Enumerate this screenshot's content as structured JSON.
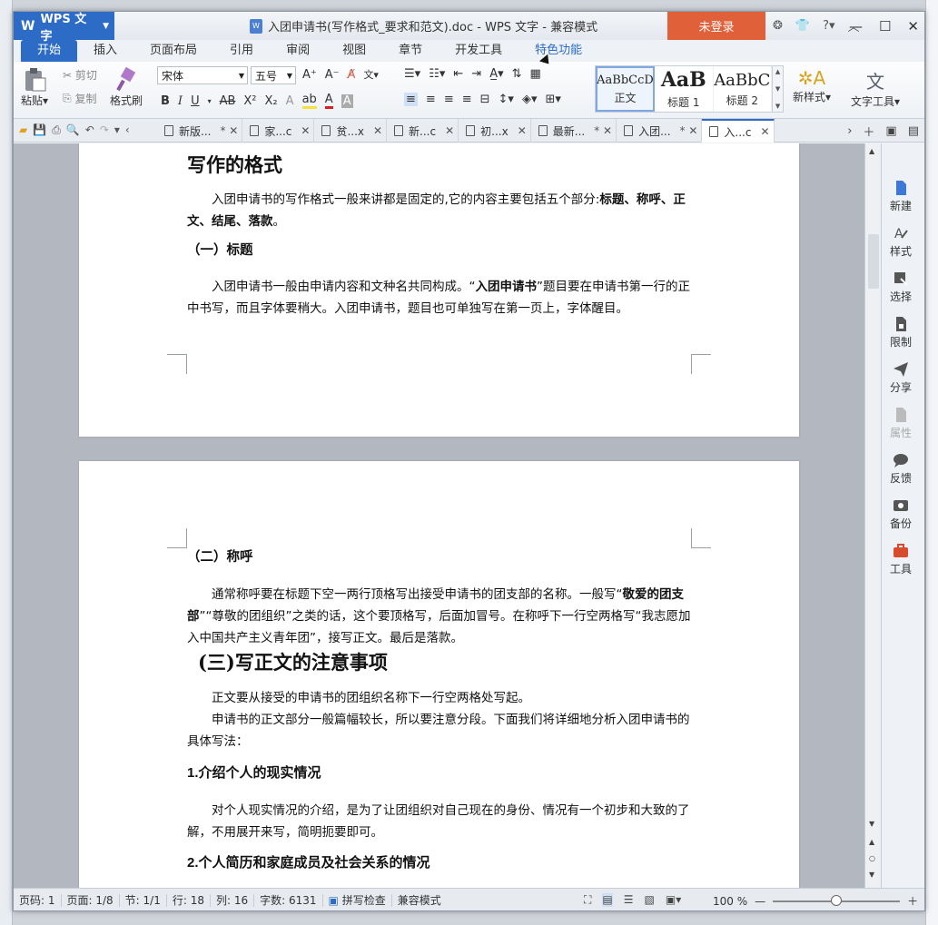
{
  "titlebar": {
    "app_name": "WPS 文字",
    "doc_title": "入团申请书(写作格式_要求和范文).doc - WPS 文字 - 兼容模式",
    "login": "未登录",
    "help": "?"
  },
  "ribbon_tabs": [
    "开始",
    "插入",
    "页面布局",
    "引用",
    "审阅",
    "视图",
    "章节",
    "开发工具",
    "特色功能"
  ],
  "ribbon": {
    "paste": "粘贴",
    "cut": "剪切",
    "copy": "复制",
    "format_painter": "格式刷",
    "font_name": "宋体",
    "font_size": "五号",
    "styles": [
      {
        "sample": "AaBbCcD",
        "label": "正文"
      },
      {
        "sample": "AaB",
        "label": "标题 1"
      },
      {
        "sample": "AaBbC",
        "label": "标题 2"
      }
    ],
    "new_style": "新样式",
    "text_tools": "文字工具"
  },
  "doc_tabs": [
    "新版...",
    "家...c",
    "贫...x",
    "新...c",
    "初...x",
    "最新...",
    "入团...",
    "入...c"
  ],
  "document": {
    "p1_heading": "写作的格式",
    "p1_intro_a": "入团申请书的写作格式一般来讲都是固定的,它的内容主要包括五个部分:",
    "p1_intro_b": "标题、称呼、正文、结尾、落款",
    "p1_intro_c": "。",
    "p1_sub1": "（一）标题",
    "p1_body_a": "入团申请书一般由申请内容和文种名共同构成。“",
    "p1_body_b": "入团申请书",
    "p1_body_c": "”题目要在申请书第一行的正中书写，而且字体要稍大。入团申请书，题目也可单独写在第一页上，字体醒目。",
    "p2_sub2": "（二）称呼",
    "p2_body_a": "通常称呼要在标题下空一两行顶格写出接受申请书的团支部的名称。一般写“",
    "p2_body_b": "敬爱的团支部",
    "p2_body_c": "”“尊敬的团组织”之类的话，这个要顶格写，后面加冒号。在称呼下一行空两格写“我志愿加入中国共产主义青年团”，接写正文。最后是落款。",
    "p2_heading3": "(三)写正文的注意事项",
    "p2_line1": "正文要从接受的申请书的团组织名称下一行空两格处写起。",
    "p2_line2": "申请书的正文部分一般篇幅较长，所以要注意分段。下面我们将详细地分析入团申请书的具体写法：",
    "p2_num1": "1.介绍个人的现实情况",
    "p2_line3": "对个人现实情况的介绍，是为了让团组织对自己现在的身份、情况有一个初步和大致的了解，不用展开来写，简明扼要即可。",
    "p2_num2": "2.个人简历和家庭成员及社会关系的情况"
  },
  "sidepanel": [
    "新建",
    "样式",
    "选择",
    "限制",
    "分享",
    "属性",
    "反馈",
    "备份",
    "工具"
  ],
  "statusbar": {
    "page_num": "页码: 1",
    "page_of": "页面: 1/8",
    "section": "节: 1/1",
    "row": "行: 18",
    "col": "列: 16",
    "words": "字数: 6131",
    "spell": "拼写检查",
    "compat": "兼容模式",
    "zoom": "100 %"
  },
  "colors": {
    "accent": "#2c6bc6",
    "login": "#e0603a"
  }
}
